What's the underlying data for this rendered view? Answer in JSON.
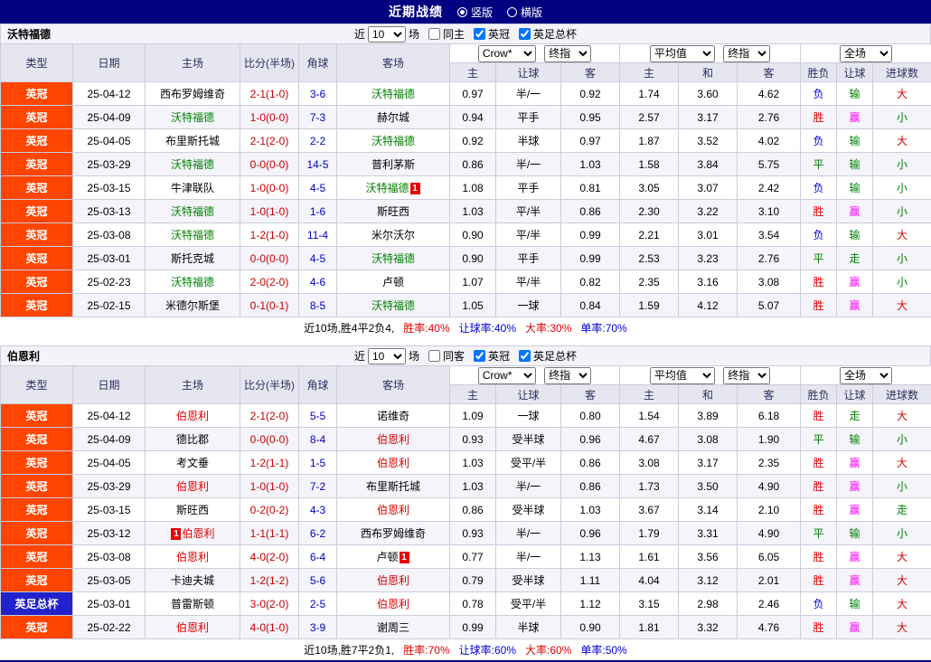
{
  "titlebar": {
    "title": "近期战绩",
    "layout_options": [
      {
        "label": "竖版",
        "selected": true
      },
      {
        "label": "横版",
        "selected": false
      }
    ]
  },
  "selects": {
    "bookmaker": "Crow*",
    "bookmaker_stage": "终指",
    "average": "平均值",
    "average_stage": "终指",
    "scope": "全场"
  },
  "columns": {
    "type": "类型",
    "date": "日期",
    "home": "主场",
    "score": "比分(半场)",
    "corner": "角球",
    "away": "客场",
    "asian_home": "主",
    "asian_line": "让球",
    "asian_away": "客",
    "euro_home": "主",
    "euro_draw": "和",
    "euro_away": "客",
    "result": "胜负",
    "asian_result": "让球",
    "goals_result": "进球数"
  },
  "colors": {
    "topbar_bg": "#010080",
    "league_badge_bg": "#FF4500",
    "cup_badge_bg": "#2222CC",
    "watford_text": "#008000",
    "burnley_text": "#E00000",
    "score_text": "#C80000",
    "corner_text": "#0000C8",
    "win_text": "#E00000",
    "draw_text": "#008000",
    "loss_text": "#0000E0",
    "cover_win_text": "#FF00FF",
    "cover_lose_text": "#008000",
    "over_text": "#E00000",
    "under_text": "#008000"
  },
  "sections": [
    {
      "team": "沃特福德",
      "filter": {
        "near": "近",
        "count": "10",
        "games": "场",
        "same_venue": "同主",
        "league": "英冠",
        "cup": "英足总杯"
      },
      "rows": [
        {
          "type": "英冠",
          "date": "25-04-12",
          "home": "西布罗姆维奇",
          "home_focal": false,
          "score": "2-1(1-0)",
          "corner": "3-6",
          "away": "沃特福德",
          "away_focal": true,
          "asian_home": "0.97",
          "asian_line": "半/一",
          "asian_away": "0.92",
          "euro_home": "1.74",
          "euro_draw": "3.60",
          "euro_away": "4.62",
          "result": "负",
          "asian_result": "输",
          "goals_result": "大"
        },
        {
          "type": "英冠",
          "date": "25-04-09",
          "home": "沃特福德",
          "home_focal": true,
          "score": "1-0(0-0)",
          "corner": "7-3",
          "away": "赫尔城",
          "away_focal": false,
          "asian_home": "0.94",
          "asian_line": "平手",
          "asian_away": "0.95",
          "euro_home": "2.57",
          "euro_draw": "3.17",
          "euro_away": "2.76",
          "result": "胜",
          "asian_result": "赢",
          "goals_result": "小"
        },
        {
          "type": "英冠",
          "date": "25-04-05",
          "home": "布里斯托城",
          "home_focal": false,
          "score": "2-1(2-0)",
          "corner": "2-2",
          "away": "沃特福德",
          "away_focal": true,
          "asian_home": "0.92",
          "asian_line": "半球",
          "asian_away": "0.97",
          "euro_home": "1.87",
          "euro_draw": "3.52",
          "euro_away": "4.02",
          "result": "负",
          "asian_result": "输",
          "goals_result": "大"
        },
        {
          "type": "英冠",
          "date": "25-03-29",
          "home": "沃特福德",
          "home_focal": true,
          "score": "0-0(0-0)",
          "corner": "14-5",
          "away": "普利茅斯",
          "away_focal": false,
          "asian_home": "0.86",
          "asian_line": "半/一",
          "asian_away": "1.03",
          "euro_home": "1.58",
          "euro_draw": "3.84",
          "euro_away": "5.75",
          "result": "平",
          "asian_result": "输",
          "goals_result": "小"
        },
        {
          "type": "英冠",
          "date": "25-03-15",
          "home": "牛津联队",
          "home_focal": false,
          "score": "1-0(0-0)",
          "corner": "4-5",
          "away": "沃特福德",
          "away_focal": true,
          "away_badge_post": "1",
          "asian_home": "1.08",
          "asian_line": "平手",
          "asian_away": "0.81",
          "euro_home": "3.05",
          "euro_draw": "3.07",
          "euro_away": "2.42",
          "result": "负",
          "asian_result": "输",
          "goals_result": "小"
        },
        {
          "type": "英冠",
          "date": "25-03-13",
          "home": "沃特福德",
          "home_focal": true,
          "score": "1-0(1-0)",
          "corner": "1-6",
          "away": "斯旺西",
          "away_focal": false,
          "asian_home": "1.03",
          "asian_line": "平/半",
          "asian_away": "0.86",
          "euro_home": "2.30",
          "euro_draw": "3.22",
          "euro_away": "3.10",
          "result": "胜",
          "asian_result": "赢",
          "goals_result": "小"
        },
        {
          "type": "英冠",
          "date": "25-03-08",
          "home": "沃特福德",
          "home_focal": true,
          "score": "1-2(1-0)",
          "corner": "11-4",
          "away": "米尔沃尔",
          "away_focal": false,
          "asian_home": "0.90",
          "asian_line": "平/半",
          "asian_away": "0.99",
          "euro_home": "2.21",
          "euro_draw": "3.01",
          "euro_away": "3.54",
          "result": "负",
          "asian_result": "输",
          "goals_result": "大"
        },
        {
          "type": "英冠",
          "date": "25-03-01",
          "home": "斯托克城",
          "home_focal": false,
          "score": "0-0(0-0)",
          "corner": "4-5",
          "away": "沃特福德",
          "away_focal": true,
          "asian_home": "0.90",
          "asian_line": "平手",
          "asian_away": "0.99",
          "euro_home": "2.53",
          "euro_draw": "3.23",
          "euro_away": "2.76",
          "result": "平",
          "asian_result": "走",
          "goals_result": "小"
        },
        {
          "type": "英冠",
          "date": "25-02-23",
          "home": "沃特福德",
          "home_focal": true,
          "score": "2-0(2-0)",
          "corner": "4-6",
          "away": "卢顿",
          "away_focal": false,
          "asian_home": "1.07",
          "asian_line": "平/半",
          "asian_away": "0.82",
          "euro_home": "2.35",
          "euro_draw": "3.16",
          "euro_away": "3.08",
          "result": "胜",
          "asian_result": "赢",
          "goals_result": "小"
        },
        {
          "type": "英冠",
          "date": "25-02-15",
          "home": "米德尔斯堡",
          "home_focal": false,
          "score": "0-1(0-1)",
          "corner": "8-5",
          "away": "沃特福德",
          "away_focal": true,
          "asian_home": "1.05",
          "asian_line": "一球",
          "asian_away": "0.84",
          "euro_home": "1.59",
          "euro_draw": "4.12",
          "euro_away": "5.07",
          "result": "胜",
          "asian_result": "赢",
          "goals_result": "大"
        }
      ],
      "summary": {
        "record": "近10场,胜4平2负4,",
        "win_rate": "胜率:40%",
        "handicap_rate": "让球率:40%",
        "big_rate": "大率:30%",
        "single_rate": "单率:70%"
      }
    },
    {
      "team": "伯恩利",
      "filter": {
        "near": "近",
        "count": "10",
        "games": "场",
        "same_venue": "同客",
        "league": "英冠",
        "cup": "英足总杯"
      },
      "rows": [
        {
          "type": "英冠",
          "date": "25-04-12",
          "home": "伯恩利",
          "home_focal": true,
          "score": "2-1(2-0)",
          "corner": "5-5",
          "away": "诺维奇",
          "away_focal": false,
          "asian_home": "1.09",
          "asian_line": "一球",
          "asian_away": "0.80",
          "euro_home": "1.54",
          "euro_draw": "3.89",
          "euro_away": "6.18",
          "result": "胜",
          "asian_result": "走",
          "goals_result": "大"
        },
        {
          "type": "英冠",
          "date": "25-04-09",
          "home": "德比郡",
          "home_focal": false,
          "score": "0-0(0-0)",
          "corner": "8-4",
          "away": "伯恩利",
          "away_focal": true,
          "asian_home": "0.93",
          "asian_line": "受半球",
          "asian_away": "0.96",
          "euro_home": "4.67",
          "euro_draw": "3.08",
          "euro_away": "1.90",
          "result": "平",
          "asian_result": "输",
          "goals_result": "小"
        },
        {
          "type": "英冠",
          "date": "25-04-05",
          "home": "考文垂",
          "home_focal": false,
          "score": "1-2(1-1)",
          "corner": "1-5",
          "away": "伯恩利",
          "away_focal": true,
          "asian_home": "1.03",
          "asian_line": "受平/半",
          "asian_away": "0.86",
          "euro_home": "3.08",
          "euro_draw": "3.17",
          "euro_away": "2.35",
          "result": "胜",
          "asian_result": "赢",
          "goals_result": "大"
        },
        {
          "type": "英冠",
          "date": "25-03-29",
          "home": "伯恩利",
          "home_focal": true,
          "score": "1-0(1-0)",
          "corner": "7-2",
          "away": "布里斯托城",
          "away_focal": false,
          "asian_home": "1.03",
          "asian_line": "半/一",
          "asian_away": "0.86",
          "euro_home": "1.73",
          "euro_draw": "3.50",
          "euro_away": "4.90",
          "result": "胜",
          "asian_result": "赢",
          "goals_result": "小"
        },
        {
          "type": "英冠",
          "date": "25-03-15",
          "home": "斯旺西",
          "home_focal": false,
          "score": "0-2(0-2)",
          "corner": "4-3",
          "away": "伯恩利",
          "away_focal": true,
          "asian_home": "0.86",
          "asian_line": "受半球",
          "asian_away": "1.03",
          "euro_home": "3.67",
          "euro_draw": "3.14",
          "euro_away": "2.10",
          "result": "胜",
          "asian_result": "赢",
          "goals_result": "走"
        },
        {
          "type": "英冠",
          "date": "25-03-12",
          "home": "伯恩利",
          "home_focal": true,
          "home_badge_pre": "1",
          "score": "1-1(1-1)",
          "corner": "6-2",
          "away": "西布罗姆维奇",
          "away_focal": false,
          "asian_home": "0.93",
          "asian_line": "半/一",
          "asian_away": "0.96",
          "euro_home": "1.79",
          "euro_draw": "3.31",
          "euro_away": "4.90",
          "result": "平",
          "asian_result": "输",
          "goals_result": "小"
        },
        {
          "type": "英冠",
          "date": "25-03-08",
          "home": "伯恩利",
          "home_focal": true,
          "score": "4-0(2-0)",
          "corner": "6-4",
          "away": "卢顿",
          "away_focal": false,
          "away_badge_post": "1",
          "asian_home": "0.77",
          "asian_line": "半/一",
          "asian_away": "1.13",
          "euro_home": "1.61",
          "euro_draw": "3.56",
          "euro_away": "6.05",
          "result": "胜",
          "asian_result": "赢",
          "goals_result": "大"
        },
        {
          "type": "英冠",
          "date": "25-03-05",
          "home": "卡迪夫城",
          "home_focal": false,
          "score": "1-2(1-2)",
          "corner": "5-6",
          "away": "伯恩利",
          "away_focal": true,
          "asian_home": "0.79",
          "asian_line": "受半球",
          "asian_away": "1.11",
          "euro_home": "4.04",
          "euro_draw": "3.12",
          "euro_away": "2.01",
          "result": "胜",
          "asian_result": "赢",
          "goals_result": "大"
        },
        {
          "type": "英足总杯",
          "date": "25-03-01",
          "home": "普雷斯顿",
          "home_focal": false,
          "score": "3-0(2-0)",
          "corner": "2-5",
          "away": "伯恩利",
          "away_focal": true,
          "asian_home": "0.78",
          "asian_line": "受平/半",
          "asian_away": "1.12",
          "euro_home": "3.15",
          "euro_draw": "2.98",
          "euro_away": "2.46",
          "result": "负",
          "asian_result": "输",
          "goals_result": "大"
        },
        {
          "type": "英冠",
          "date": "25-02-22",
          "home": "伯恩利",
          "home_focal": true,
          "score": "4-0(1-0)",
          "corner": "3-9",
          "away": "谢周三",
          "away_focal": false,
          "asian_home": "0.99",
          "asian_line": "半球",
          "asian_away": "0.90",
          "euro_home": "1.81",
          "euro_draw": "3.32",
          "euro_away": "4.76",
          "result": "胜",
          "asian_result": "赢",
          "goals_result": "大"
        }
      ],
      "summary": {
        "record": "近10场,胜7平2负1,",
        "win_rate": "胜率:70%",
        "handicap_rate": "让球率:60%",
        "big_rate": "大率:60%",
        "single_rate": "单率:50%"
      }
    }
  ]
}
